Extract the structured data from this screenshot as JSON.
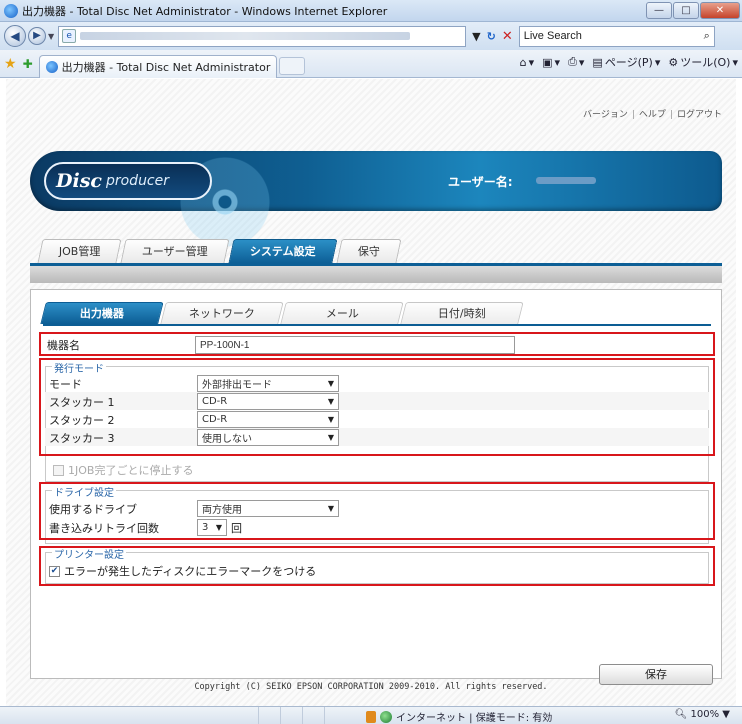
{
  "window": {
    "title": "出力機器 - Total Disc Net Administrator - Windows Internet Explorer",
    "minimize": "—",
    "maximize": "□",
    "close": "✕"
  },
  "addressbar": {
    "search_value": "Live Search",
    "search_icon": "search-icon"
  },
  "browser_tab": {
    "label": "出力機器 - Total Disc Net Administrator"
  },
  "commandbar": {
    "page_label": "ページ(P)",
    "tools_label": "ツール(O)"
  },
  "top_links": {
    "version": "バージョン",
    "help": "ヘルプ",
    "logout": "ログアウト"
  },
  "banner": {
    "logo_disc": "Disc",
    "logo_producer": "producer",
    "user_label": "ユーザー名:"
  },
  "main_tabs": [
    {
      "label": "JOB管理",
      "active": false
    },
    {
      "label": "ユーザー管理",
      "active": false
    },
    {
      "label": "システム設定",
      "active": true
    },
    {
      "label": "保守",
      "active": false
    }
  ],
  "sub_tabs": [
    {
      "label": "出力機器",
      "active": true
    },
    {
      "label": "ネットワーク",
      "active": false
    },
    {
      "label": "メール",
      "active": false
    },
    {
      "label": "日付/時刻",
      "active": false
    }
  ],
  "device_name": {
    "label": "機器名",
    "value": "PP-100N-1"
  },
  "issue_mode": {
    "legend": "発行モード",
    "mode_label": "モード",
    "mode_value": "外部排出モード",
    "stacker1_label": "スタッカー 1",
    "stacker1_value": "CD-R",
    "stacker2_label": "スタッカー 2",
    "stacker2_value": "CD-R",
    "stacker3_label": "スタッカー 3",
    "stacker3_value": "使用しない",
    "stop_each_job_label": "1JOB完了ごとに停止する",
    "stop_each_job_checked": false
  },
  "drive_settings": {
    "legend": "ドライブ設定",
    "drive_label": "使用するドライブ",
    "drive_value": "両方使用",
    "retry_label": "書き込みリトライ回数",
    "retry_value": "3",
    "retry_unit": "回"
  },
  "printer_settings": {
    "legend": "プリンター設定",
    "error_mark_label": "エラーが発生したディスクにエラーマークをつける",
    "error_mark_checked": true
  },
  "save_label": "保存",
  "copyright": "Copyright (C) SEIKO EPSON CORPORATION 2009-2010. All rights reserved.",
  "statusbar": {
    "zone": "インターネット | 保護モード: 有効",
    "zoom": "100%"
  },
  "colors": {
    "accent": "#0d5f96",
    "highlight": "#d8161b"
  }
}
